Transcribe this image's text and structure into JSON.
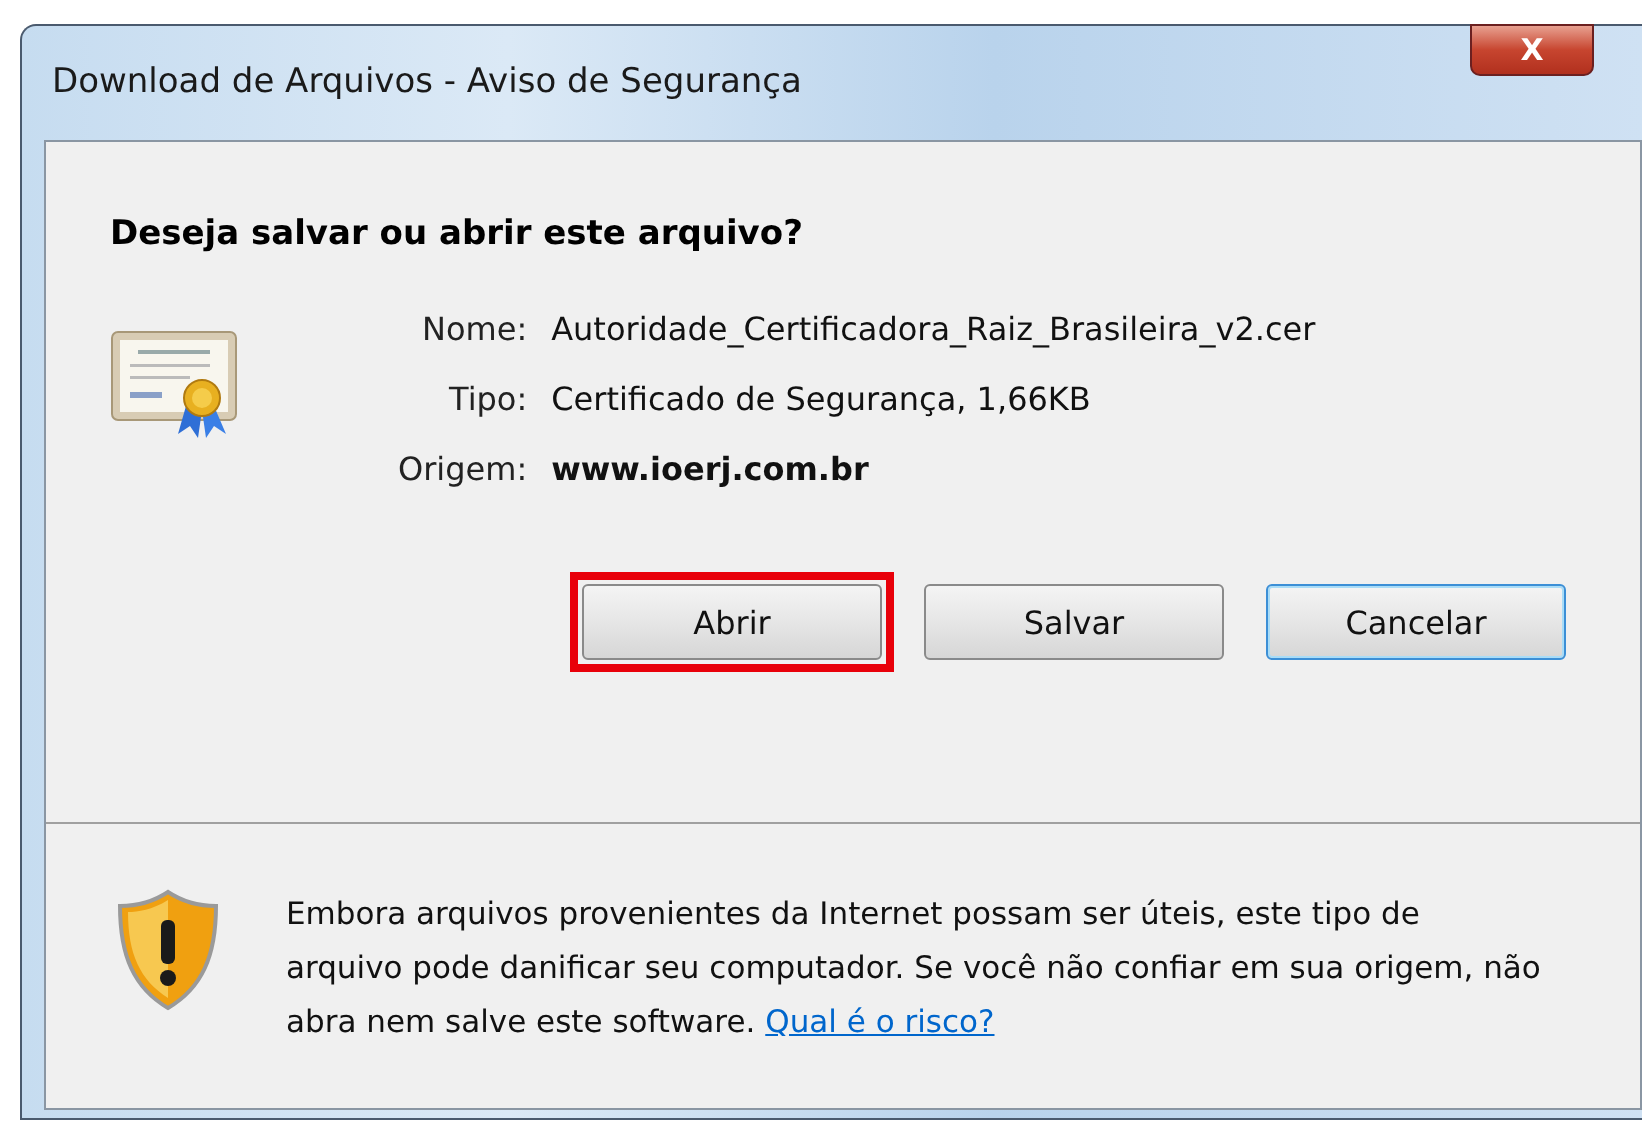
{
  "window": {
    "title": "Download de Arquivos - Aviso de Segurança",
    "close": "X"
  },
  "heading": "Deseja salvar ou abrir este arquivo?",
  "details": [
    {
      "label": "Nome:",
      "value": "Autoridade_Certificadora_Raiz_Brasileira_v2.cer",
      "bold": false
    },
    {
      "label": "Tipo:",
      "value": "Certificado de Segurança, 1,66KB",
      "bold": false
    },
    {
      "label": "Origem:",
      "value": "www.ioerj.com.br",
      "bold": true
    }
  ],
  "buttons": [
    {
      "label": "Abrir",
      "highlighted": true,
      "focused": false
    },
    {
      "label": "Salvar",
      "highlighted": false,
      "focused": false
    },
    {
      "label": "Cancelar",
      "highlighted": false,
      "focused": true
    }
  ],
  "warning": {
    "text": "Embora arquivos provenientes da Internet possam ser úteis, este tipo de arquivo pode danificar seu computador. Se você não confiar em sua origem, não abra nem salve este software.",
    "link": "Qual é o risco?"
  }
}
